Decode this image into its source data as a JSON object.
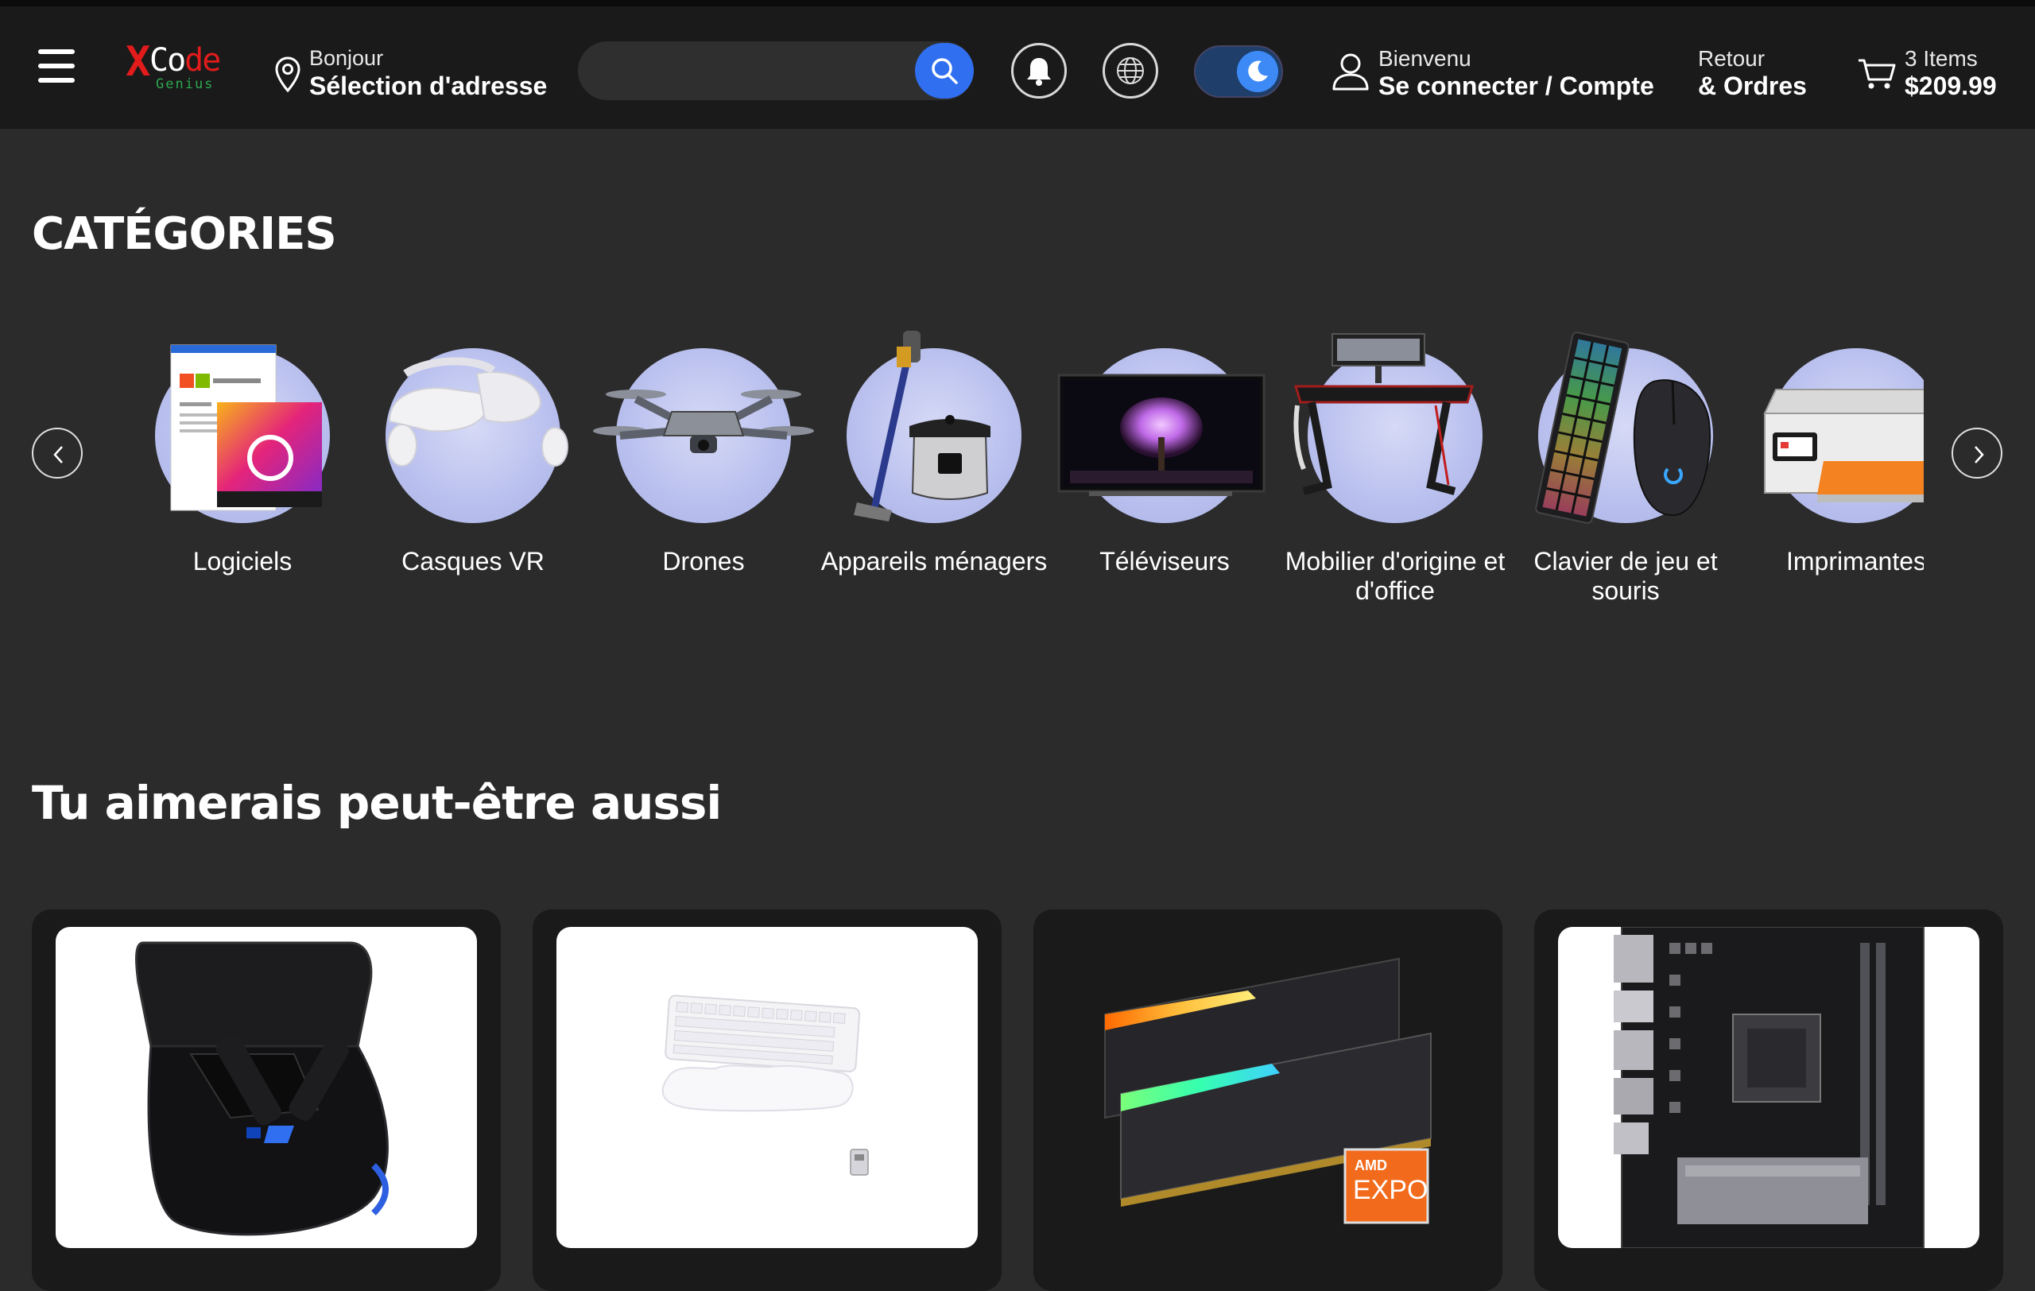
{
  "header": {
    "logo": {
      "x": "X",
      "word_main": "Co",
      "word_accent": "de",
      "sub": "Genius"
    },
    "address": {
      "greeting": "Bonjour",
      "label": "Sélection d'adresse"
    },
    "search": {
      "placeholder": "",
      "value": ""
    },
    "account": {
      "greeting": "Bienvenu",
      "label": "Se connecter / Compte"
    },
    "returns": {
      "line1": "Retour",
      "line2": "& Ordres"
    },
    "cart": {
      "items": "3 Items",
      "total": "$209.99"
    }
  },
  "categories": {
    "title": "CATÉGORIES",
    "items": [
      {
        "label": "Logiciels",
        "icon": "software-box-image"
      },
      {
        "label": "Casques VR",
        "icon": "vr-headset-image"
      },
      {
        "label": "Drones",
        "icon": "drone-image"
      },
      {
        "label": "Appareils ménagers",
        "icon": "appliance-image"
      },
      {
        "label": "Téléviseurs",
        "icon": "tv-image"
      },
      {
        "label": "Mobilier d'origine et d'office",
        "icon": "desk-image"
      },
      {
        "label": "Clavier de jeu et souris",
        "icon": "keyboard-mouse-image"
      },
      {
        "label": "Imprimantes",
        "icon": "printer-image"
      }
    ]
  },
  "recommendations": {
    "title": "Tu aimerais peut-être aussi",
    "products": [
      {
        "image": "rog-earbuds-image"
      },
      {
        "image": "white-keyboard-image"
      },
      {
        "image": "trident-ram-image",
        "badge_brand": "AMD",
        "badge_text": "EXPO"
      },
      {
        "image": "asrock-motherboard-image"
      }
    ]
  },
  "colors": {
    "background": "#2b2b2b",
    "header": "#1a1a1a",
    "accent_blue": "#2f6ff0",
    "logo_red": "#e21b1b",
    "logo_green": "#2fa84f",
    "category_circle": "#b9c0ee"
  }
}
